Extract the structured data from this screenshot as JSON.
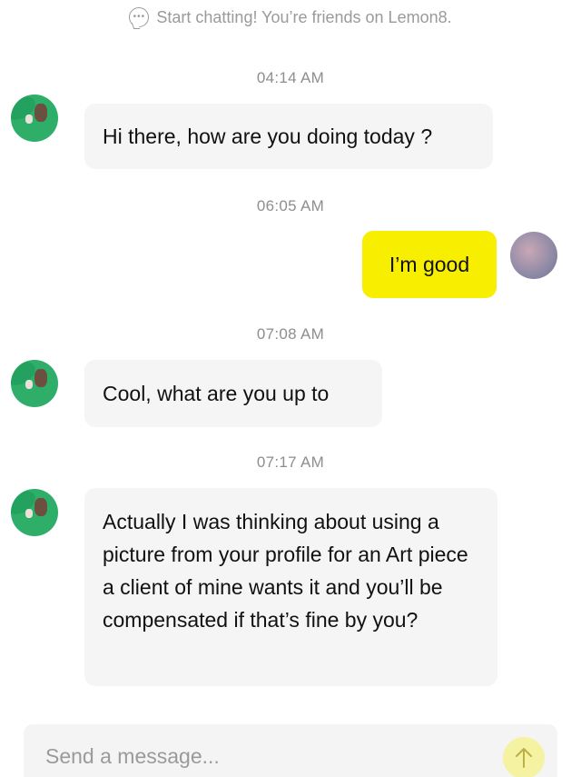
{
  "notice": {
    "icon": "chat-bubble-icon",
    "text": "Start chatting! You’re friends on Lemon8."
  },
  "messages": [
    {
      "timestamp": "04:14 AM",
      "sender": "friend",
      "text": "Hi there, how are you doing today ?"
    },
    {
      "timestamp": "06:05 AM",
      "sender": "me",
      "text": "I’m good"
    },
    {
      "timestamp": "07:08 AM",
      "sender": "friend",
      "text": "Cool, what are you up to"
    },
    {
      "timestamp": "07:17 AM",
      "sender": "friend",
      "text": "Actually I was thinking about using a picture from your profile for an Art piece a client of mine wants it and you’ll be compensated if that’s fine by you?"
    }
  ],
  "composer": {
    "placeholder": "Send a message...",
    "send_icon": "arrow-up-icon"
  },
  "colors": {
    "outgoing_bubble": "#f8ee00",
    "incoming_bubble": "#f5f5f5",
    "send_button": "#f5f2a2",
    "friend_avatar": "#2fae6a"
  }
}
